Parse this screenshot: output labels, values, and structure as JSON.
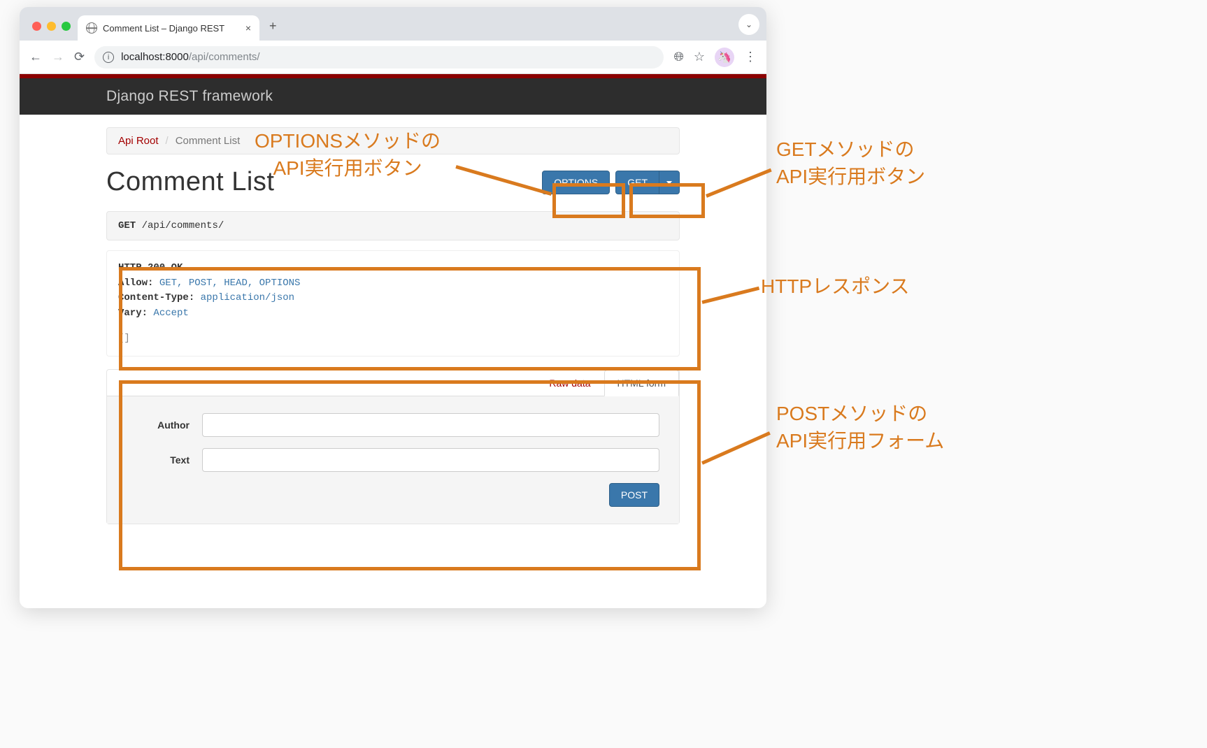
{
  "browser": {
    "tab_title": "Comment List – Django REST",
    "url_host": "localhost:8000",
    "url_path": "/api/comments/"
  },
  "navbar": {
    "brand": "Django REST framework"
  },
  "breadcrumb": {
    "root": "Api Root",
    "sep": "/",
    "active": "Comment List"
  },
  "page": {
    "title": "Comment List"
  },
  "buttons": {
    "options": "OPTIONS",
    "get": "GET",
    "post": "POST"
  },
  "request": {
    "method": "GET",
    "path": "/api/comments/"
  },
  "response": {
    "status": "HTTP 200 OK",
    "headers": [
      {
        "k": "Allow:",
        "v": "GET, POST, HEAD, OPTIONS"
      },
      {
        "k": "Content-Type:",
        "v": "application/json"
      },
      {
        "k": "Vary:",
        "v": "Accept"
      }
    ],
    "body": "[]"
  },
  "form": {
    "tab_raw": "Raw data",
    "tab_html": "HTML form",
    "fields": {
      "author_label": "Author",
      "text_label": "Text"
    }
  },
  "annotations": {
    "options": "OPTIONSメソッドの\nAPI実行用ボタン",
    "get": "GETメソッドの\nAPI実行用ボタン",
    "response": "HTTPレスポンス",
    "post": "POSTメソッドの\nAPI実行用フォーム"
  }
}
